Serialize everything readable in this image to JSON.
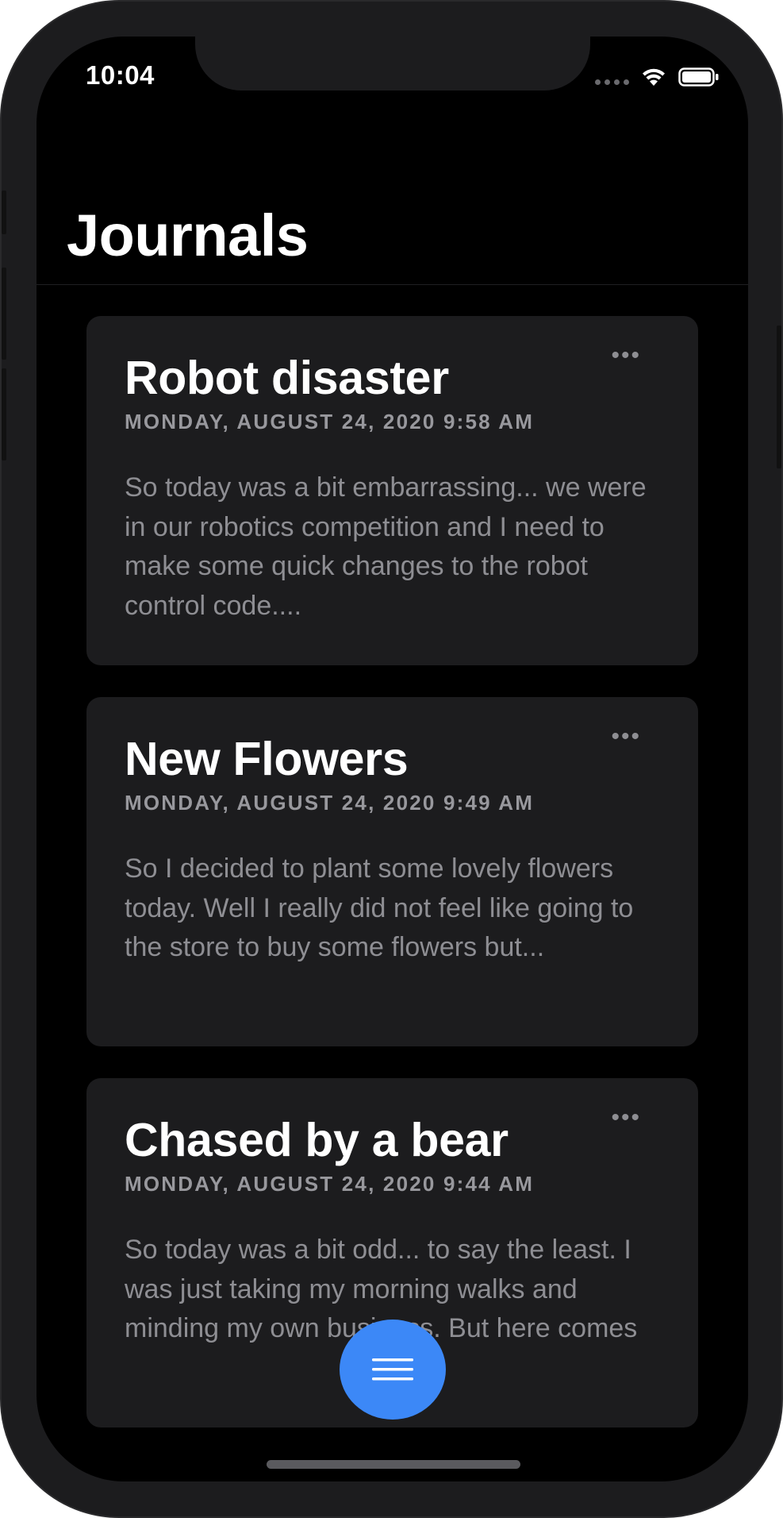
{
  "status_bar": {
    "time": "10:04"
  },
  "header": {
    "title": "Journals"
  },
  "entries": [
    {
      "title": "Robot disaster",
      "date": "MONDAY, AUGUST 24, 2020 9:58 AM",
      "preview": "So today was a bit embarrassing... we were in our robotics competition and I need to make some quick changes to the robot control code....",
      "more_label": "•••"
    },
    {
      "title": "New Flowers",
      "date": "MONDAY, AUGUST 24, 2020 9:49 AM",
      "preview": "So I decided to plant some lovely flowers today. Well I really did not feel like going to the store to buy some flowers but...",
      "more_label": "•••"
    },
    {
      "title": "Chased by a bear",
      "date": "MONDAY, AUGUST 24, 2020 9:44 AM",
      "preview": "So today was a bit odd... to say the least. I was just taking my morning walks and minding my own business. But here comes",
      "more_label": "•••"
    }
  ],
  "fab": {
    "icon": "menu-icon",
    "color": "#3c88f7"
  },
  "colors": {
    "background": "#000000",
    "card": "#1c1c1e",
    "accent": "#3c88f7"
  }
}
